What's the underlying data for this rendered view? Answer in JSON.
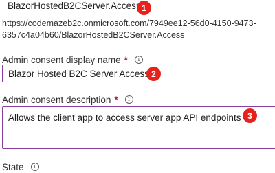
{
  "scope_name": {
    "value": "BlazorHostedB2CServer.Access",
    "badge": "1"
  },
  "scope_uri": {
    "line1": "https://codemazeb2c.onmicrosoft.com/7949ee12-56d0-4150-9473-",
    "line2": "6357c4a04b60/BlazorHostedB2CServer.Access"
  },
  "admin_display_name": {
    "label": "Admin consent display name",
    "required_marker": "*",
    "info_icon": "info-icon",
    "value": "Blazor Hosted B2C Server Access",
    "badge": "2"
  },
  "admin_description": {
    "label": "Admin consent description",
    "required_marker": "*",
    "info_icon": "info-icon",
    "value": "Allows the client app to access server app API endpoints",
    "badge": "3"
  },
  "state": {
    "label": "State",
    "info_icon": "info-icon"
  },
  "colors": {
    "focus_border": "#8a3ea0",
    "badge": "#e8221b",
    "required": "#a4262c"
  }
}
